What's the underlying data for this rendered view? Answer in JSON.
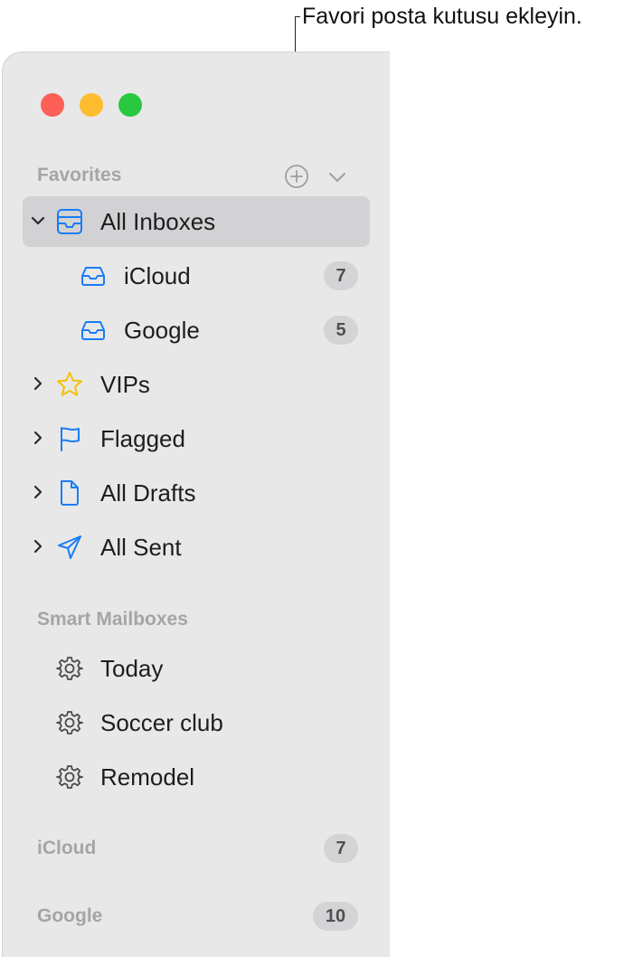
{
  "callout": {
    "text": "Favori posta kutusu ekleyin."
  },
  "sidebar": {
    "favorites": {
      "header": "Favorites",
      "items": [
        {
          "label": "All Inboxes",
          "icon": "all-inboxes-icon",
          "selected": true,
          "expanded": true
        },
        {
          "label": "iCloud",
          "icon": "inbox-tray-icon",
          "badge": "7"
        },
        {
          "label": "Google",
          "icon": "inbox-tray-icon",
          "badge": "5"
        },
        {
          "label": "VIPs",
          "icon": "star-icon"
        },
        {
          "label": "Flagged",
          "icon": "flag-icon"
        },
        {
          "label": "All Drafts",
          "icon": "document-icon"
        },
        {
          "label": "All Sent",
          "icon": "paper-plane-icon"
        }
      ]
    },
    "smart_mailboxes": {
      "header": "Smart Mailboxes",
      "items": [
        {
          "label": "Today",
          "icon": "gear-icon"
        },
        {
          "label": "Soccer club",
          "icon": "gear-icon"
        },
        {
          "label": "Remodel",
          "icon": "gear-icon"
        }
      ]
    },
    "accounts": [
      {
        "label": "iCloud",
        "badge": "7"
      },
      {
        "label": "Google",
        "badge": "10"
      }
    ]
  },
  "colors": {
    "accent": "#1a7cf5",
    "star": "#f2c300",
    "close": "#fe5f57",
    "minimize": "#febc2e",
    "zoom": "#28c840"
  }
}
